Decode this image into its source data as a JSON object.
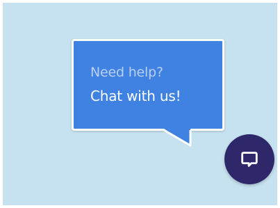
{
  "help_bubble": {
    "line1": "Need help?",
    "line2": "Chat with us!"
  },
  "chat_launcher": {
    "icon": "chat-bubble-icon"
  },
  "colors": {
    "background": "#c6e1ef",
    "bubble": "#3f82e1",
    "bubble_border": "#ffffff",
    "launcher": "#2e286a"
  }
}
